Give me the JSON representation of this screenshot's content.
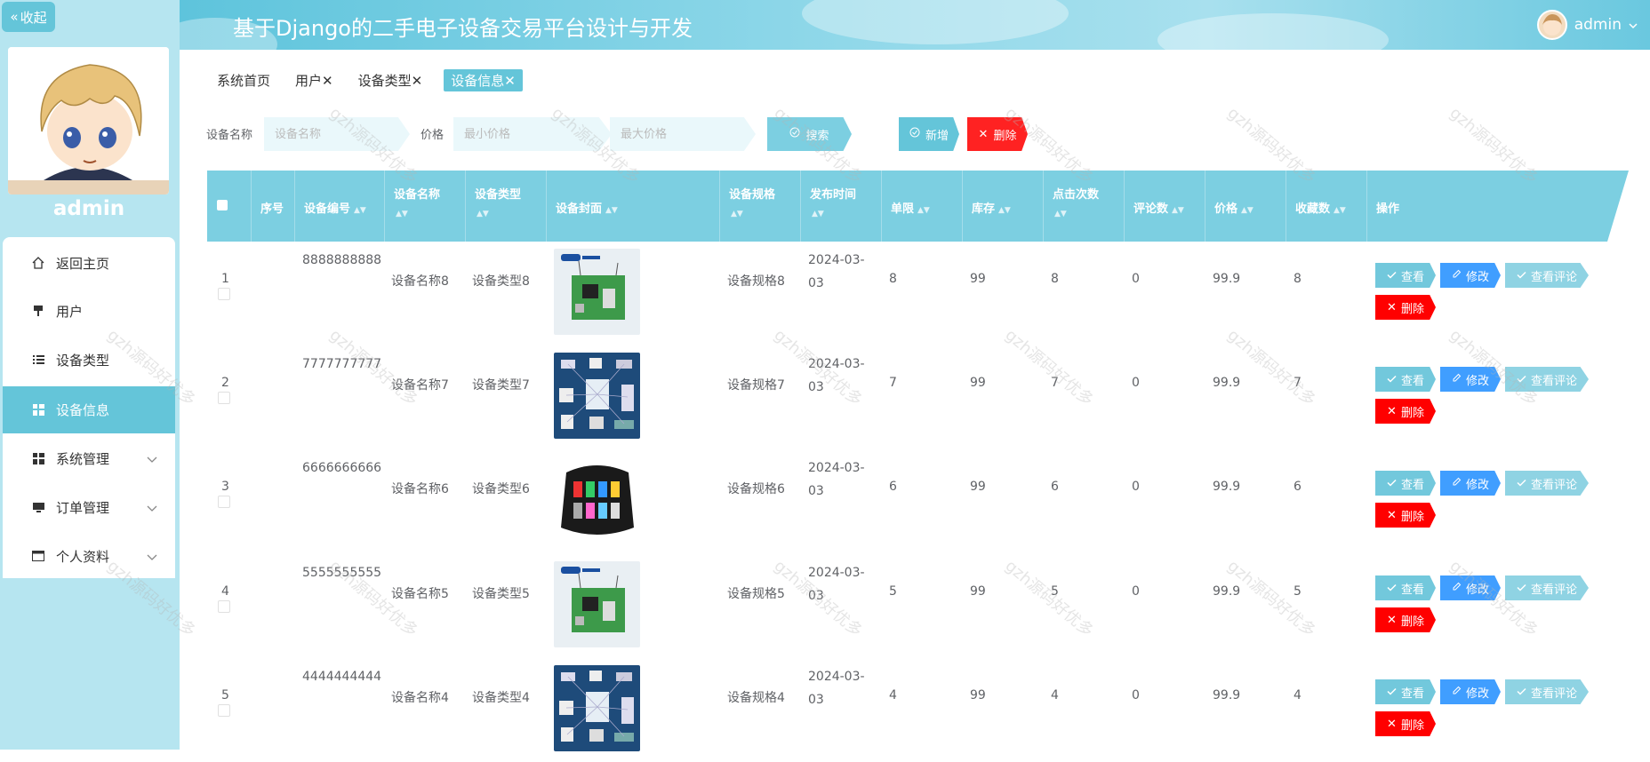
{
  "sidebar": {
    "collapse_label": "收起",
    "username": "admin",
    "menu": [
      {
        "label": "返回主页",
        "icon": "home-icon"
      },
      {
        "label": "用户",
        "icon": "pin-icon"
      },
      {
        "label": "设备类型",
        "icon": "list-icon"
      },
      {
        "label": "设备信息",
        "icon": "grid-icon",
        "active": true
      },
      {
        "label": "系统管理",
        "icon": "grid-icon"
      },
      {
        "label": "订单管理",
        "icon": "monitor-icon"
      },
      {
        "label": "个人资料",
        "icon": "card-icon"
      }
    ]
  },
  "header": {
    "title": "基于Django的二手电子设备交易平台设计与开发",
    "user": "admin"
  },
  "tags": [
    {
      "label": "系统首页"
    },
    {
      "label": "用户",
      "close": "✕"
    },
    {
      "label": "设备类型",
      "close": "✕"
    },
    {
      "label": "设备信息",
      "close": "✕",
      "active": true
    }
  ],
  "search": {
    "name_label": "设备名称",
    "name_placeholder": "设备名称",
    "price_label": "价格",
    "min_placeholder": "最小价格",
    "max_placeholder": "最大价格",
    "search_btn": "搜索",
    "add_btn": "新增",
    "delete_btn": "删除"
  },
  "table": {
    "columns": [
      "序号",
      "设备编号",
      "设备名称",
      "设备类型",
      "设备封面",
      "设备规格",
      "发布时间",
      "单限",
      "库存",
      "点击次数",
      "评论数",
      "价格",
      "收藏数",
      "操作"
    ],
    "actions": {
      "view": "查看",
      "edit": "修改",
      "comments": "查看评论",
      "delete": "删除"
    },
    "rows": [
      {
        "idx": "1",
        "code": "8888888888",
        "name": "设备名称8",
        "type": "设备类型8",
        "cover": "board",
        "spec": "设备规格8",
        "date": "2024-03-03",
        "limit": "8",
        "stock": "99",
        "clicks": "8",
        "comments": "0",
        "price": "99.9",
        "favs": "8"
      },
      {
        "idx": "2",
        "code": "7777777777",
        "name": "设备名称7",
        "type": "设备类型7",
        "cover": "iot",
        "spec": "设备规格7",
        "date": "2024-03-03",
        "limit": "7",
        "stock": "99",
        "clicks": "7",
        "comments": "0",
        "price": "99.9",
        "favs": "7"
      },
      {
        "idx": "3",
        "code": "6666666666",
        "name": "设备名称6",
        "type": "设备类型6",
        "cover": "case",
        "spec": "设备规格6",
        "date": "2024-03-03",
        "limit": "6",
        "stock": "99",
        "clicks": "6",
        "comments": "0",
        "price": "99.9",
        "favs": "6"
      },
      {
        "idx": "4",
        "code": "5555555555",
        "name": "设备名称5",
        "type": "设备类型5",
        "cover": "board",
        "spec": "设备规格5",
        "date": "2024-03-03",
        "limit": "5",
        "stock": "99",
        "clicks": "5",
        "comments": "0",
        "price": "99.9",
        "favs": "5"
      },
      {
        "idx": "5",
        "code": "4444444444",
        "name": "设备名称4",
        "type": "设备类型4",
        "cover": "iot",
        "spec": "设备规格4",
        "date": "2024-03-03",
        "limit": "4",
        "stock": "99",
        "clicks": "4",
        "comments": "0",
        "price": "99.9",
        "favs": "4"
      }
    ]
  },
  "watermark": "gzh源码好优多",
  "colors": {
    "accent": "#64c5d9",
    "header_row": "#7ccfe1",
    "edit": "#409eff",
    "danger": "#ff0000",
    "sidebar_bg": "#b6e5f0"
  }
}
